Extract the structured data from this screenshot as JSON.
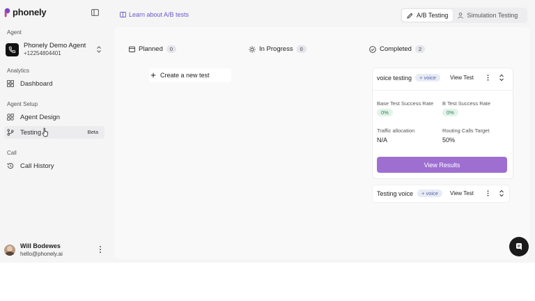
{
  "brand": {
    "name": "phonely",
    "accent": "#9e6fd1"
  },
  "sidebar": {
    "agent_section": "Agent",
    "agent": {
      "name": "Phonely Demo Agent",
      "phone": "+12254804401"
    },
    "analytics_section": "Analytics",
    "dashboard": "Dashboard",
    "agent_setup_section": "Agent Setup",
    "agent_design": "Agent Design",
    "testing": "Testing",
    "testing_badge": "Beta",
    "call_section": "Call",
    "call_history": "Call History",
    "user": {
      "name": "Will Bodewes",
      "email": "hello@phonely.ai"
    }
  },
  "topbar": {
    "learn_link": "Learn about A/B tests",
    "tabs": [
      {
        "label": "A/B Testing",
        "icon": "pencil-icon",
        "active": true
      },
      {
        "label": "Simulation Testing",
        "icon": "person-icon",
        "active": false
      }
    ]
  },
  "board": {
    "columns": [
      {
        "title": "Planned",
        "count": "0",
        "icon": "calendar-icon"
      },
      {
        "title": "In Progress",
        "count": "0",
        "icon": "sun-icon"
      },
      {
        "title": "Completed",
        "count": "2",
        "icon": "check-circle-icon"
      }
    ],
    "create_label": "Create a new test",
    "cards": [
      {
        "title": "voice testing",
        "tag": "+ voice",
        "view": "View Test",
        "base_label": "Base Test Success Rate",
        "base_value": "0%",
        "b_label": "B Test Success Rate",
        "b_value": "0%",
        "traffic_label": "Traffic allocation",
        "traffic_value": "N/A",
        "routing_label": "Routing Calls Target",
        "routing_value": "50%",
        "results_button": "View Results"
      },
      {
        "title": "Testing voice",
        "tag": "+ voice",
        "view": "View Test"
      }
    ]
  }
}
